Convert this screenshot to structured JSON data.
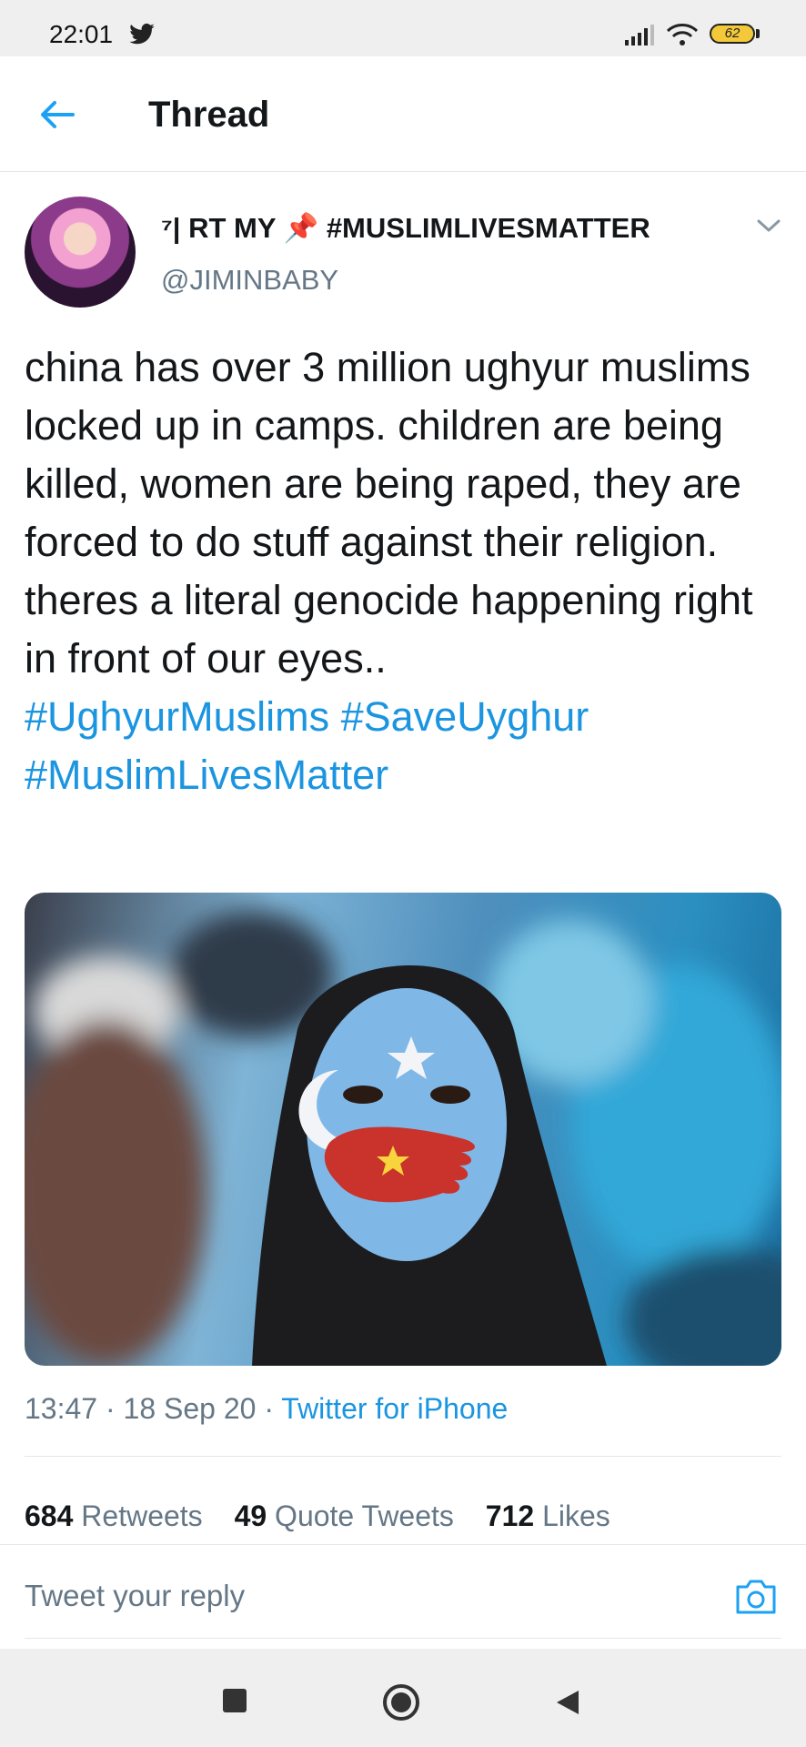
{
  "status_bar": {
    "time": "22:01",
    "battery": "62",
    "icons": [
      "twitter-icon",
      "signal-icon",
      "wifi-icon",
      "battery-icon"
    ]
  },
  "header": {
    "title": "Thread",
    "back_icon": "back-arrow-icon"
  },
  "tweet": {
    "name_prefix": "⁷| RT MY",
    "name_pin": "📌",
    "name_suffix": "#MUSLIMLIVESMATTER",
    "handle": "@JIMINBABY",
    "text": "china has over 3 million ughyur muslims locked up in camps. children are being killed, women are being raped, they are forced to do stuff against their religion. theres a literal genocide happening right in front of our eyes..",
    "hashtags": [
      "#UghyurMuslims",
      "#SaveUyghur",
      "#MuslimLivesMatter"
    ],
    "time": "13:47",
    "date": "18 Sep 20",
    "source": "Twitter for iPhone",
    "retweets_count": "684",
    "retweets_label": "Retweets",
    "quotes_count": "49",
    "quotes_label": "Quote Tweets",
    "likes_count": "712",
    "likes_label": "Likes"
  },
  "reply": {
    "placeholder": "Tweet your reply"
  },
  "colors": {
    "link": "#1b95e0",
    "secondary_text": "#657786",
    "primary_text": "#14171a"
  }
}
